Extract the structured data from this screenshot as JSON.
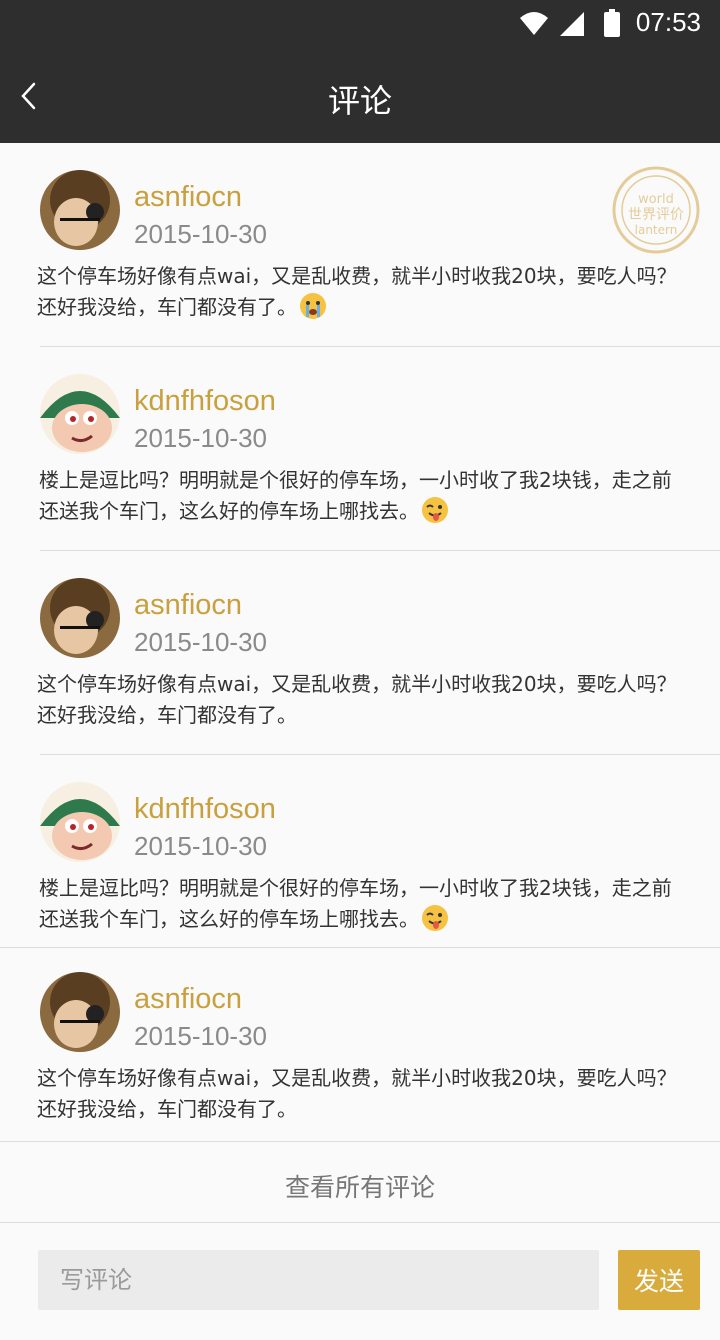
{
  "status_bar": {
    "time": "07:53",
    "icons": [
      "wifi-icon",
      "cell-signal-icon",
      "battery-icon"
    ]
  },
  "header": {
    "title": "评论",
    "back_icon": "chevron-left-icon"
  },
  "stamp": {
    "lettering": "world lantern 世界评价",
    "icon": "stamp-icon"
  },
  "comments": [
    {
      "user": "asnfiocn",
      "date": "2015-10-30",
      "line1": "这个停车场好像有点wai，又是乱收费，就半小时收我20块，要吃人吗？",
      "line2": "还好我没给，车门都没有了。",
      "emoji": "crying-face-emoji"
    },
    {
      "user": "kdnfhfoson",
      "date": "2015-10-30",
      "line1": "楼上是逗比吗？明明就是个很好的停车场，一小时收了我2块钱，走之前",
      "line2": "还送我个车门，这么好的停车场上哪找去。",
      "emoji": "winking-tongue-emoji"
    },
    {
      "user": "asnfiocn",
      "date": "2015-10-30",
      "line1": "这个停车场好像有点wai，又是乱收费，就半小时收我20块，要吃人吗？",
      "line2": "还好我没给，车门都没有了。",
      "emoji": ""
    },
    {
      "user": "kdnfhfoson",
      "date": "2015-10-30",
      "line1": "楼上是逗比吗？明明就是个很好的停车场，一小时收了我2块钱，走之前",
      "line2": "还送我个车门，这么好的停车场上哪找去。",
      "emoji": "winking-tongue-emoji"
    },
    {
      "user": "asnfiocn",
      "date": "2015-10-30",
      "line1": "这个停车场好像有点wai，又是乱收费，就半小时收我20块，要吃人吗？",
      "line2": "还好我没给，车门都没有了。",
      "emoji": ""
    }
  ],
  "view_all": {
    "label": "查看所有评论"
  },
  "composer": {
    "placeholder": "写评论",
    "send_label": "发送"
  },
  "colors": {
    "accent": "#d8ab3c",
    "username": "#c9a03e",
    "header_bg": "#2e2e2e"
  }
}
